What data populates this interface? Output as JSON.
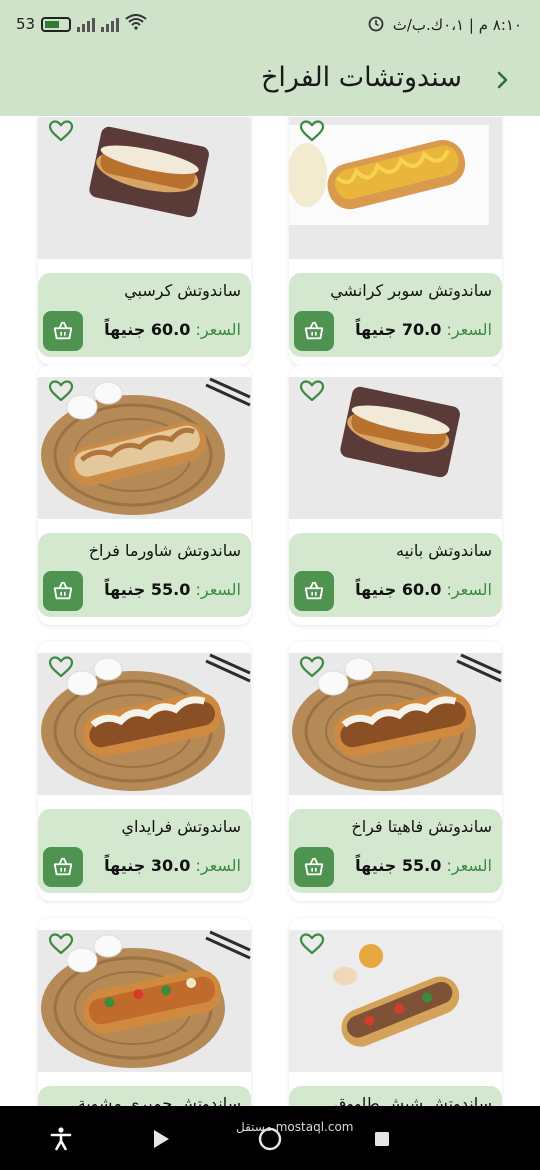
{
  "status_bar": {
    "time": "٨:١٠ م | ٠،١ك.ب/ث",
    "battery": "53"
  },
  "header": {
    "title": "سندوتشات الفراخ"
  },
  "price_label": "السعر:",
  "products": [
    {
      "name": "ساندوتش سوبر كرانشي",
      "price": "70.0 جنيهاً",
      "image": "crispy-hotdog-cheese"
    },
    {
      "name": "ساندوتش كرسبي",
      "price": "60.0 جنيهاً",
      "image": "crispy-board"
    },
    {
      "name": "ساندوتش بانيه",
      "price": "60.0 جنيهاً",
      "image": "crispy-board"
    },
    {
      "name": "ساندوتش شاورما فراخ",
      "price": "55.0 جنيهاً",
      "image": "shawarma-mat"
    },
    {
      "name": "ساندوتش فاهيتا فراخ",
      "price": "55.0 جنيهاً",
      "image": "sub-mat-sauce"
    },
    {
      "name": "ساندوتش فرايداي",
      "price": "30.0 جنيهاً",
      "image": "sub-mat-sauce"
    },
    {
      "name": "ساندوتش شيش طاووق",
      "price": "",
      "image": "kebab-plate"
    },
    {
      "name": "ساندوتش جمبري مشوية",
      "price": "",
      "image": "sub-mat-veg"
    }
  ],
  "watermark": "مستقل mostaql.com",
  "colors": {
    "header_bg": "#cfe3cb",
    "info_bg": "#d4e8cf",
    "accent": "#4e9350",
    "price_label": "#3c8a41"
  },
  "icons": {
    "back": "chevron-right-icon",
    "favorite": "heart-outline-icon",
    "cart": "shopping-basket-icon",
    "nav": [
      "accessibility-icon",
      "play-icon",
      "home-circle-icon",
      "stop-square-icon"
    ]
  }
}
